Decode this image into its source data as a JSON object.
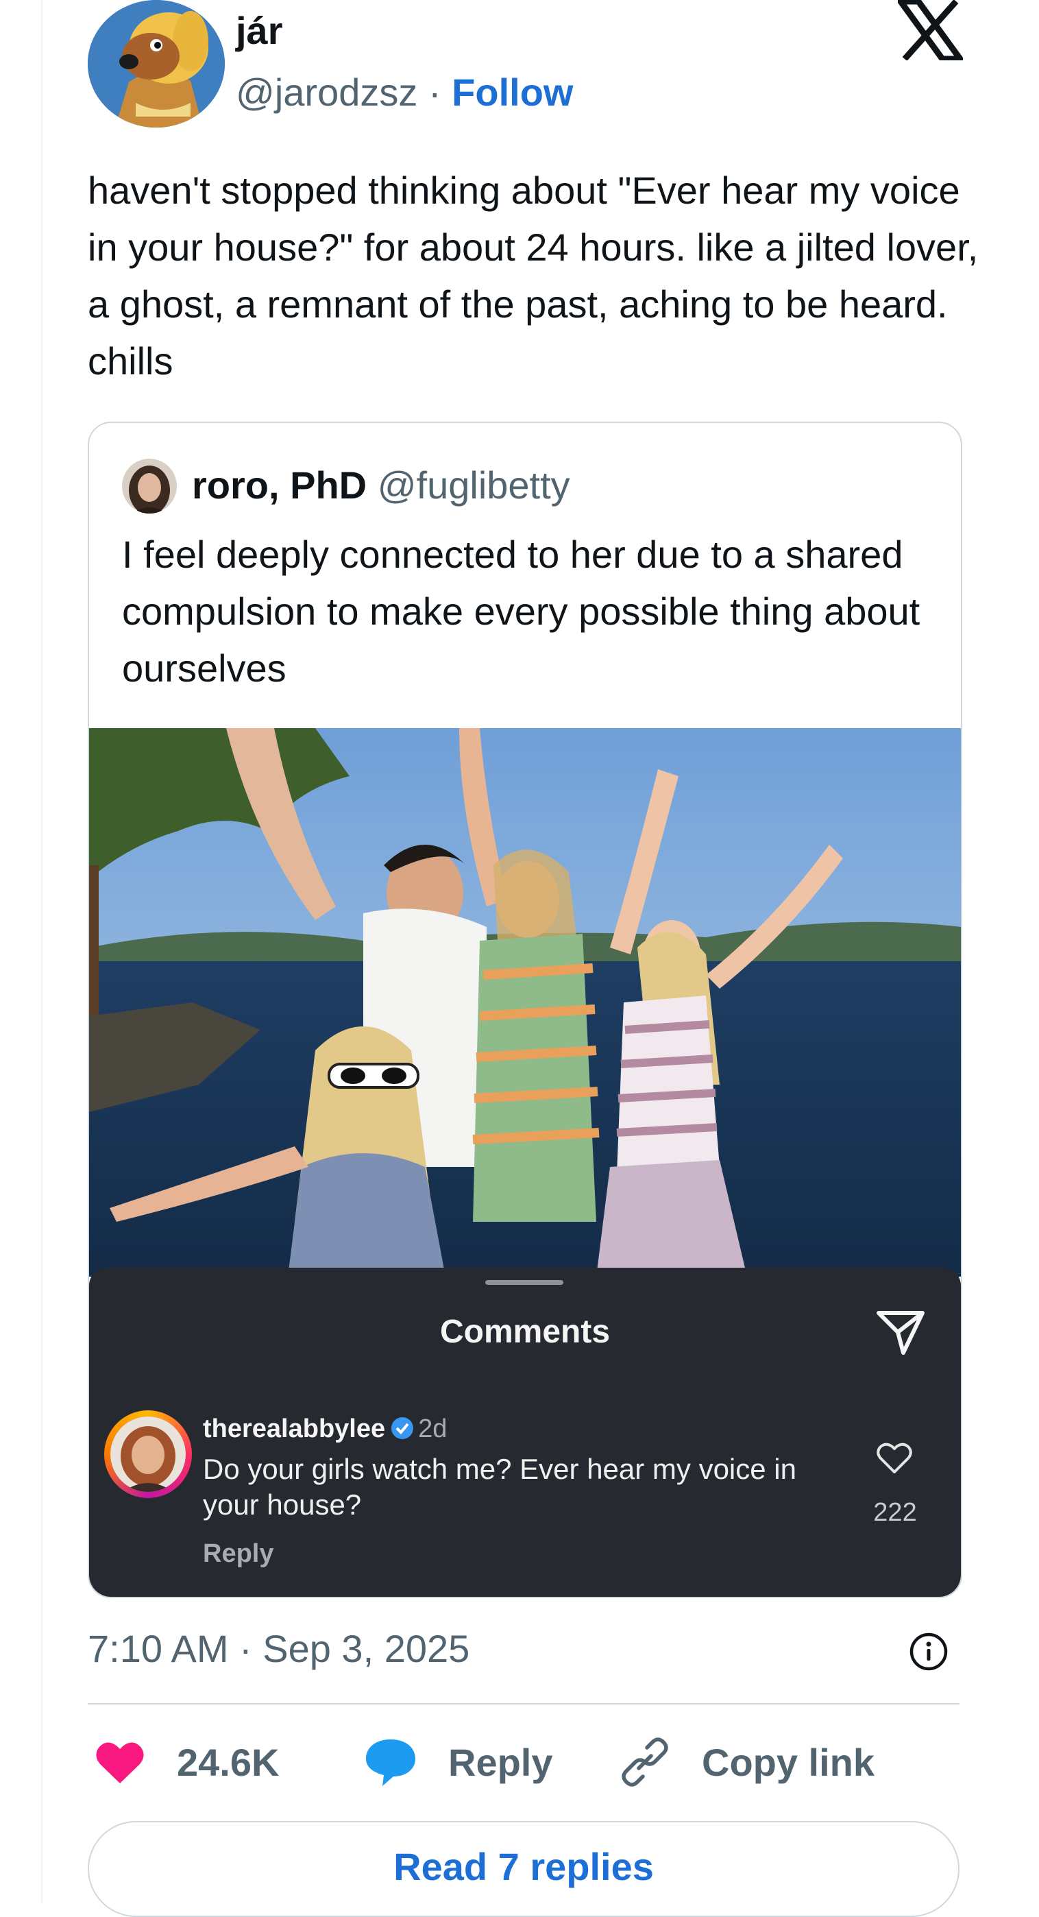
{
  "author": {
    "display_name": "jár",
    "handle": "@jarodzsz",
    "separator": "·",
    "follow_label": "Follow"
  },
  "tweet": {
    "text": "haven't stopped thinking about \"Ever hear my voice in your house?\" for about 24 hours. like a jilted lover, a ghost, a remnant of the past, aching to be heard. chills",
    "timestamp": "7:10 AM · Sep 3, 2025"
  },
  "quote": {
    "display_name": "roro, PhD",
    "handle": "@fuglibetty",
    "text": "I feel deeply connected to her due to a shared compulsion to make every possible thing about ourselves"
  },
  "instagram_comments": {
    "title": "Comments",
    "comment": {
      "username": "therealabbylee",
      "time": "2d",
      "text": "Do your girls watch me? Ever hear my voice in your house?",
      "reply_label": "Reply",
      "like_count": "222"
    }
  },
  "actions": {
    "like_count": "24.6K",
    "reply_label": "Reply",
    "copy_link_label": "Copy link"
  },
  "read_replies_label": "Read 7 replies",
  "colors": {
    "link_blue": "#1d6fd6",
    "like_pink": "#f91880",
    "reply_blue": "#1d9bf0",
    "secondary_text": "#536471",
    "ig_panel": "#262a30"
  },
  "icons": [
    "x-logo-icon",
    "send-icon",
    "verified-badge-icon",
    "heart-outline-icon",
    "info-icon",
    "heart-icon",
    "speech-bubble-icon",
    "link-icon"
  ]
}
